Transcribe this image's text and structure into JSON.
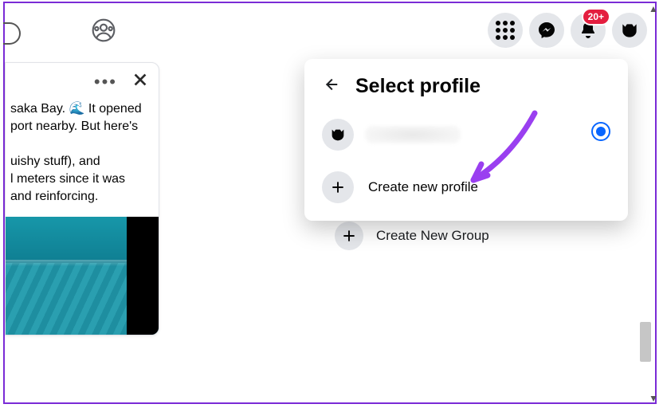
{
  "topbar": {
    "notification_badge": "20+"
  },
  "post": {
    "text_line1": "saka Bay. 🌊 It opened",
    "text_line2": "port nearby. But here's",
    "text_line3": "",
    "text_line4": "uishy stuff), and",
    "text_line5": "l meters since it was",
    "text_line6": " and reinforcing."
  },
  "background": {
    "create_group_label": "Create New Group"
  },
  "popover": {
    "title": "Select profile",
    "create_label": "Create new profile"
  },
  "icons": {
    "group": "group-icon",
    "apps": "apps-grid-icon",
    "messenger": "messenger-icon",
    "bell": "bell-icon",
    "bat_avatar": "batman-avatar",
    "more": "more-icon",
    "close": "close-icon",
    "back": "back-arrow-icon",
    "plus": "plus-icon",
    "radio_selected": "radio-selected-icon"
  }
}
